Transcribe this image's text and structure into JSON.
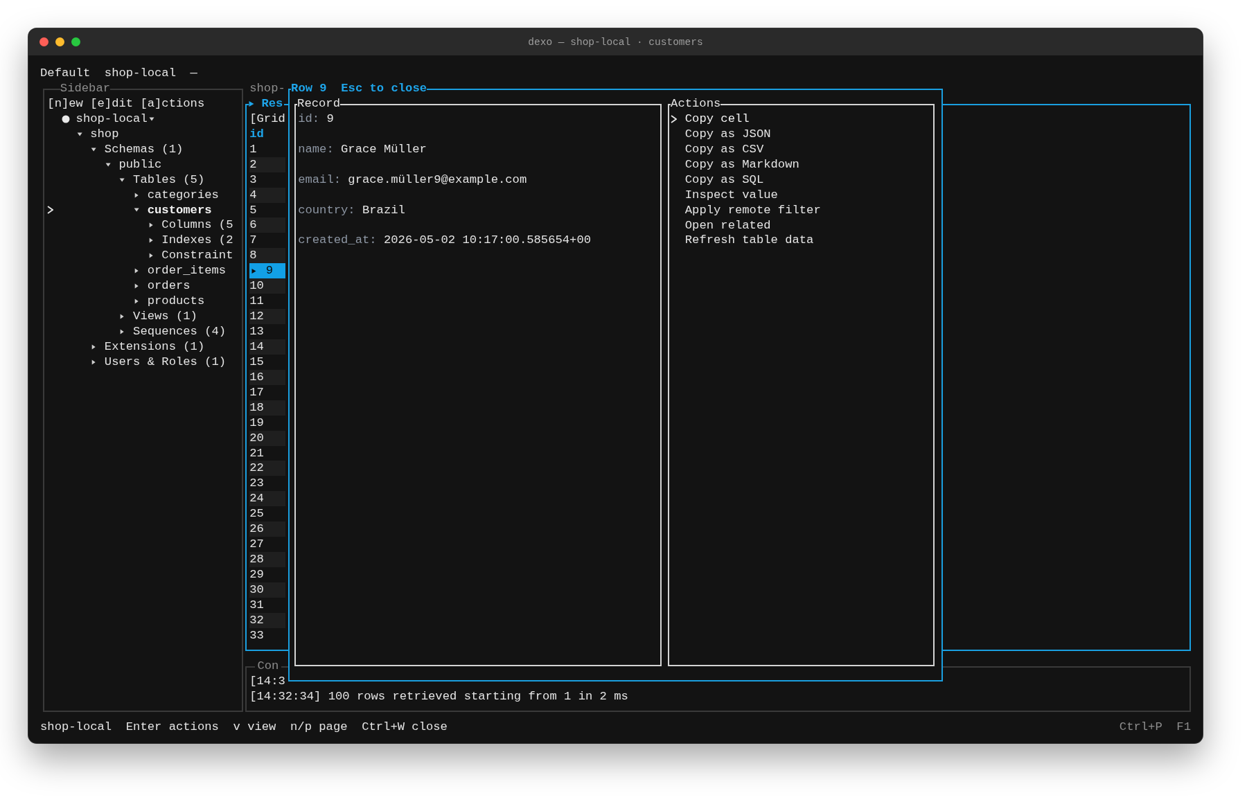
{
  "window": {
    "title": "dexo — shop-local · customers"
  },
  "header": {
    "items": [
      "Default",
      "shop-local",
      "—"
    ]
  },
  "sidebar": {
    "title": "Sidebar",
    "toolbar": "[n]ew [e]dit [a]ctions",
    "tree": [
      {
        "label": "shop-local",
        "kind": "connection",
        "connected": true,
        "expanded": true,
        "selected": false,
        "children": [
          {
            "label": "shop",
            "kind": "node",
            "expanded": true,
            "selected": false,
            "children": [
              {
                "label": "Schemas (1)",
                "kind": "node",
                "expanded": true,
                "selected": false,
                "children": [
                  {
                    "label": "public",
                    "kind": "node",
                    "expanded": true,
                    "selected": false,
                    "children": [
                      {
                        "label": "Tables (5)",
                        "kind": "node",
                        "expanded": true,
                        "selected": false,
                        "children": [
                          {
                            "label": "categories",
                            "kind": "node",
                            "expanded": false,
                            "selected": false
                          },
                          {
                            "label": "customers",
                            "kind": "node",
                            "expanded": true,
                            "selected": true,
                            "children": [
                              {
                                "label": "Columns (5",
                                "kind": "node",
                                "expanded": false,
                                "selected": false
                              },
                              {
                                "label": "Indexes (2",
                                "kind": "node",
                                "expanded": false,
                                "selected": false
                              },
                              {
                                "label": "Constraint",
                                "kind": "node",
                                "expanded": false,
                                "selected": false
                              }
                            ]
                          },
                          {
                            "label": "order_items",
                            "kind": "node",
                            "expanded": false,
                            "selected": false
                          },
                          {
                            "label": "orders",
                            "kind": "node",
                            "expanded": false,
                            "selected": false
                          },
                          {
                            "label": "products",
                            "kind": "node",
                            "expanded": false,
                            "selected": false
                          }
                        ]
                      },
                      {
                        "label": "Views (1)",
                        "kind": "node",
                        "expanded": false,
                        "selected": false
                      },
                      {
                        "label": "Sequences (4)",
                        "kind": "node",
                        "expanded": false,
                        "selected": false
                      }
                    ]
                  }
                ]
              },
              {
                "label": "Extensions (1)",
                "kind": "node",
                "expanded": false,
                "selected": false
              },
              {
                "label": "Users & Roles (1)",
                "kind": "node",
                "expanded": false,
                "selected": false
              }
            ]
          }
        ]
      }
    ]
  },
  "results": {
    "tab": "shop-",
    "title": "Res",
    "mode": "[Grid",
    "column": "id",
    "rows": [
      {
        "value": "1",
        "selected": false
      },
      {
        "value": "2",
        "selected": false
      },
      {
        "value": "3",
        "selected": false
      },
      {
        "value": "4",
        "selected": false
      },
      {
        "value": "5",
        "selected": false
      },
      {
        "value": "6",
        "selected": false
      },
      {
        "value": "7",
        "selected": false
      },
      {
        "value": "8",
        "selected": false
      },
      {
        "value": "9",
        "selected": true
      },
      {
        "value": "10",
        "selected": false
      },
      {
        "value": "11",
        "selected": false
      },
      {
        "value": "12",
        "selected": false
      },
      {
        "value": "13",
        "selected": false
      },
      {
        "value": "14",
        "selected": false
      },
      {
        "value": "15",
        "selected": false
      },
      {
        "value": "16",
        "selected": false
      },
      {
        "value": "17",
        "selected": false
      },
      {
        "value": "18",
        "selected": false
      },
      {
        "value": "19",
        "selected": false
      },
      {
        "value": "20",
        "selected": false
      },
      {
        "value": "21",
        "selected": false
      },
      {
        "value": "22",
        "selected": false
      },
      {
        "value": "23",
        "selected": false
      },
      {
        "value": "24",
        "selected": false
      },
      {
        "value": "25",
        "selected": false
      },
      {
        "value": "26",
        "selected": false
      },
      {
        "value": "27",
        "selected": false
      },
      {
        "value": "28",
        "selected": false
      },
      {
        "value": "29",
        "selected": false
      },
      {
        "value": "30",
        "selected": false
      },
      {
        "value": "31",
        "selected": false
      },
      {
        "value": "32",
        "selected": false
      },
      {
        "value": "33",
        "selected": false
      }
    ]
  },
  "console": {
    "title": "Con",
    "lines": [
      "[14:3",
      "[14:32:34] 100 rows retrieved starting from 1 in 2 ms"
    ]
  },
  "dialog": {
    "title": "Row 9",
    "hint": "Esc to close",
    "record": {
      "title": "Record",
      "fields": [
        {
          "label": "id:",
          "value": "9"
        },
        {
          "label": "name:",
          "value": "Grace Müller"
        },
        {
          "label": "email:",
          "value": "grace.müller9@example.com"
        },
        {
          "label": "country:",
          "value": "Brazil"
        },
        {
          "label": "created_at:",
          "value": "2026-05-02 10:17:00.585654+00"
        }
      ]
    },
    "actions": {
      "title": "Actions",
      "items": [
        {
          "label": "Copy cell",
          "selected": true
        },
        {
          "label": "Copy as JSON",
          "selected": false
        },
        {
          "label": "Copy as CSV",
          "selected": false
        },
        {
          "label": "Copy as Markdown",
          "selected": false
        },
        {
          "label": "Copy as SQL",
          "selected": false
        },
        {
          "label": "Inspect value",
          "selected": false
        },
        {
          "label": "Apply remote filter",
          "selected": false
        },
        {
          "label": "Open related",
          "selected": false
        },
        {
          "label": "Refresh table data",
          "selected": false
        }
      ]
    }
  },
  "status_bar": {
    "left": [
      "shop-local",
      "Enter actions",
      "v view",
      "n/p page",
      "Ctrl+W close"
    ],
    "right": [
      "Ctrl+P",
      "F1"
    ]
  }
}
